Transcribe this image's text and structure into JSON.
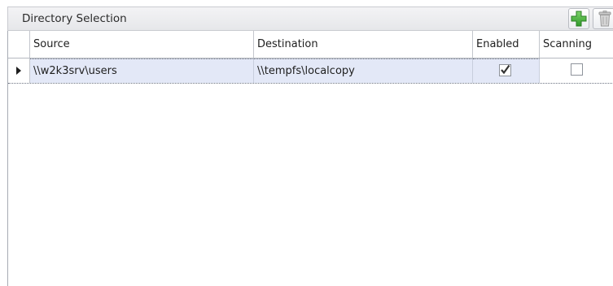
{
  "panel": {
    "title": "Directory Selection",
    "toolbar": {
      "add_icon": "plus-icon",
      "delete_icon": "trash-icon"
    }
  },
  "grid": {
    "columns": [
      "Source",
      "Destination",
      "Enabled",
      "Scanning"
    ],
    "rows": [
      {
        "source": "\\\\w2k3srv\\users",
        "destination": "\\\\tempfs\\localcopy",
        "enabled": true,
        "scanning": false
      }
    ]
  },
  "colors": {
    "selection_bg": "#e3e8f7",
    "add_green": "#3aa335",
    "border": "#c3c6cc"
  }
}
